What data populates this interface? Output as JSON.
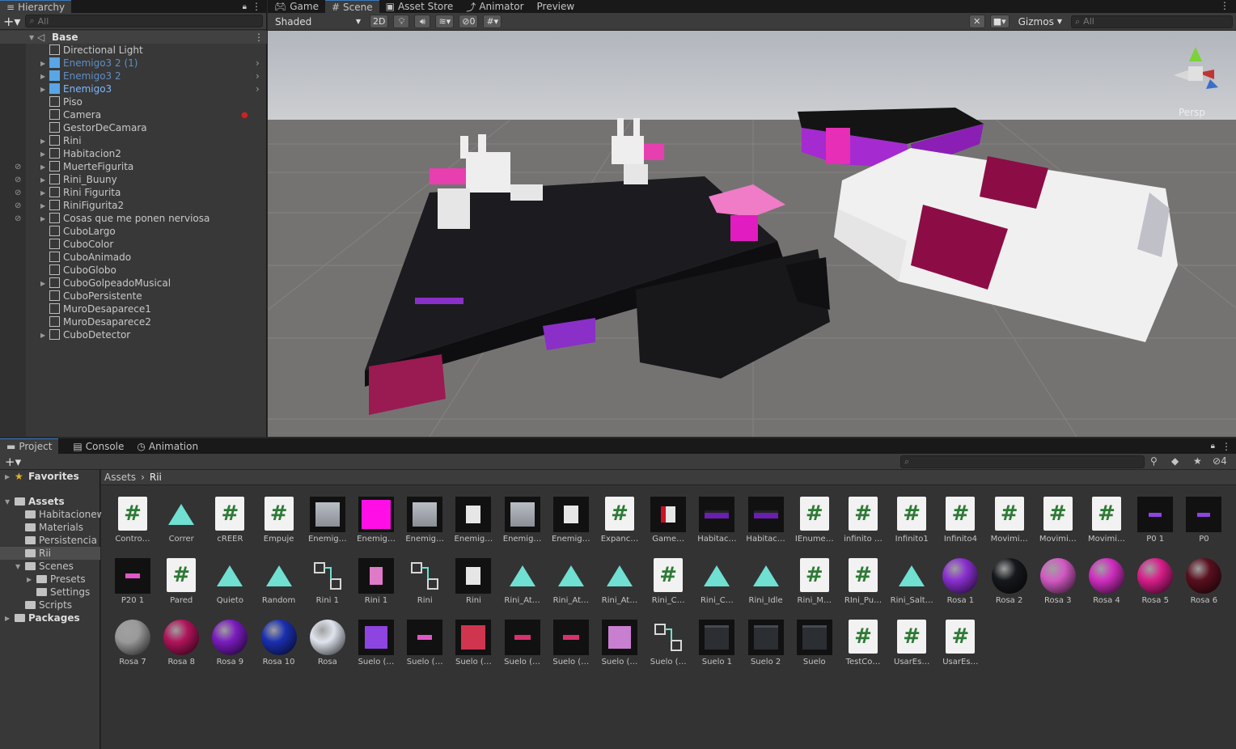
{
  "hierarchy": {
    "tab_label": "Hierarchy",
    "search_placeholder": "All",
    "scene_name": "Base",
    "items": [
      {
        "label": "Directional Light",
        "prefab": false,
        "muted": false
      },
      {
        "label": "Enemigo3 2 (1)",
        "prefab": true,
        "muted": true
      },
      {
        "label": "Enemigo3 2",
        "prefab": true,
        "muted": true
      },
      {
        "label": "Enemigo3",
        "prefab": true,
        "muted": false
      },
      {
        "label": "Piso",
        "prefab": false,
        "muted": false
      },
      {
        "label": "Camera",
        "prefab": false,
        "muted": false
      },
      {
        "label": "GestorDeCamara",
        "prefab": false,
        "muted": false
      },
      {
        "label": "Rini",
        "prefab": false,
        "muted": false
      },
      {
        "label": "Habitacion2",
        "prefab": false,
        "muted": false
      },
      {
        "label": "MuerteFigurita",
        "prefab": false,
        "muted": false
      },
      {
        "label": "Rini_Buuny",
        "prefab": false,
        "muted": false
      },
      {
        "label": "Rini Figurita",
        "prefab": false,
        "muted": false
      },
      {
        "label": "RiniFigurita2",
        "prefab": false,
        "muted": false
      },
      {
        "label": "Cosas que me ponen nerviosa",
        "prefab": false,
        "muted": false
      },
      {
        "label": "CuboLargo",
        "prefab": false,
        "muted": false
      },
      {
        "label": "CuboColor",
        "prefab": false,
        "muted": false
      },
      {
        "label": "CuboAnimado",
        "prefab": false,
        "muted": false
      },
      {
        "label": "CuboGlobo",
        "prefab": false,
        "muted": false
      },
      {
        "label": "CuboGolpeadoMusical",
        "prefab": false,
        "muted": false
      },
      {
        "label": "CuboPersistente",
        "prefab": false,
        "muted": false
      },
      {
        "label": "MuroDesaparece1",
        "prefab": false,
        "muted": false
      },
      {
        "label": "MuroDesaparece2",
        "prefab": false,
        "muted": false
      },
      {
        "label": "CuboDetector",
        "prefab": false,
        "muted": false
      }
    ]
  },
  "scene_tabs": [
    "Game",
    "Scene",
    "Asset Store",
    "Animator",
    "Preview"
  ],
  "scene_toolbar": {
    "shading": "Shaded",
    "mode_2d": "2D",
    "hidden_count": "0",
    "gizmos": "Gizmos",
    "search_placeholder": "All",
    "persp": "Persp"
  },
  "project_tabs": [
    "Project",
    "Console",
    "Animation"
  ],
  "project_toolbar": {
    "hidden_count": "4"
  },
  "project_tree": {
    "favorites": "Favorites",
    "assets": "Assets",
    "folders": [
      "Habitacionew",
      "Materials",
      "Persistencia",
      "Rii",
      "Scenes",
      "Presets",
      "Settings",
      "Scripts"
    ],
    "packages": "Packages"
  },
  "breadcrumb": [
    "Assets",
    "Rii"
  ],
  "assets_row1": [
    {
      "name": "Contro…",
      "kind": "script"
    },
    {
      "name": "Correr",
      "kind": "anim"
    },
    {
      "name": "cREER",
      "kind": "script"
    },
    {
      "name": "Empuje",
      "kind": "script"
    },
    {
      "name": "Enemig…",
      "kind": "greycube"
    },
    {
      "name": "Enemig…",
      "kind": "magentacube"
    },
    {
      "name": "Enemig…",
      "kind": "greycube"
    },
    {
      "name": "Enemig…",
      "kind": "bunny"
    },
    {
      "name": "Enemig…",
      "kind": "greycube"
    },
    {
      "name": "Enemig…",
      "kind": "bunny"
    },
    {
      "name": "Expanc…",
      "kind": "script"
    },
    {
      "name": "Game…",
      "kind": "bunnyred"
    },
    {
      "name": "Habitac…",
      "kind": "room"
    },
    {
      "name": "Habitac…",
      "kind": "room"
    },
    {
      "name": "IEnume…",
      "kind": "script"
    },
    {
      "name": "infinito …",
      "kind": "script"
    },
    {
      "name": "Infinito1",
      "kind": "script"
    },
    {
      "name": "Infinito4",
      "kind": "script"
    },
    {
      "name": "Movimi…",
      "kind": "script"
    },
    {
      "name": "Movimi…",
      "kind": "script"
    },
    {
      "name": "Movimi…",
      "kind": "script"
    },
    {
      "name": "P0 1",
      "kind": "purpleflat"
    },
    {
      "name": "P0",
      "kind": "purpleflat"
    }
  ],
  "assets_row2": [
    {
      "name": "P20 1",
      "kind": "pinkflat"
    },
    {
      "name": "Pared",
      "kind": "script"
    },
    {
      "name": "Quieto",
      "kind": "anim"
    },
    {
      "name": "Random",
      "kind": "anim"
    },
    {
      "name": "Rini 1",
      "kind": "controller"
    },
    {
      "name": "Rini 1",
      "kind": "pinkbunny"
    },
    {
      "name": "Rini",
      "kind": "controller"
    },
    {
      "name": "Rini",
      "kind": "bunny"
    },
    {
      "name": "Rini_At…",
      "kind": "anim"
    },
    {
      "name": "Rini_At…",
      "kind": "anim"
    },
    {
      "name": "Rini_At…",
      "kind": "anim"
    },
    {
      "name": "Rini_C…",
      "kind": "script"
    },
    {
      "name": "Rini_C…",
      "kind": "anim"
    },
    {
      "name": "Rini_Idle",
      "kind": "anim"
    },
    {
      "name": "Rini_M…",
      "kind": "script"
    },
    {
      "name": "RIni_Pu…",
      "kind": "script"
    },
    {
      "name": "Rini_Salt…",
      "kind": "anim"
    },
    {
      "name": "Rosa 1",
      "kind": "sphere",
      "color": "#8a2fd0"
    },
    {
      "name": "Rosa 2",
      "kind": "sphere",
      "color": "#15181c"
    },
    {
      "name": "Rosa 3",
      "kind": "sphere",
      "color": "#d45ac4"
    },
    {
      "name": "Rosa 4",
      "kind": "sphere",
      "color": "#d02ec0"
    },
    {
      "name": "Rosa 5",
      "kind": "sphere",
      "color": "#d81e8a"
    },
    {
      "name": "Rosa 6",
      "kind": "sphere",
      "color": "#5a0f1e"
    }
  ],
  "assets_row3": [
    {
      "name": "Rosa 7",
      "kind": "sphere",
      "color": "#9a9a9a"
    },
    {
      "name": "Rosa 8",
      "kind": "sphere",
      "color": "#b0145a"
    },
    {
      "name": "Rosa 9",
      "kind": "sphere",
      "color": "#7a1cbf"
    },
    {
      "name": "Rosa 10",
      "kind": "sphere",
      "color": "#1a2fb0"
    },
    {
      "name": "Rosa",
      "kind": "sphere",
      "color": "#dfe4ee"
    },
    {
      "name": "Suelo (…",
      "kind": "purplecube"
    },
    {
      "name": "Suelo (…",
      "kind": "pinkflat"
    },
    {
      "name": "Suelo (…",
      "kind": "redcube"
    },
    {
      "name": "Suelo (…",
      "kind": "pinkflat2"
    },
    {
      "name": "Suelo (…",
      "kind": "pinkflat2"
    },
    {
      "name": "Suelo (…",
      "kind": "lilaccube"
    },
    {
      "name": "Suelo (…",
      "kind": "controller"
    },
    {
      "name": "Suelo 1",
      "kind": "blackcube"
    },
    {
      "name": "Suelo 2",
      "kind": "blackcube"
    },
    {
      "name": "Suelo",
      "kind": "blackcube"
    },
    {
      "name": "TestCo…",
      "kind": "script"
    },
    {
      "name": "UsarEs…",
      "kind": "script"
    },
    {
      "name": "UsarEs…",
      "kind": "script"
    }
  ],
  "colors": {
    "panel": "#383838",
    "toolbar": "#3c3c3c",
    "tabbar": "#191919",
    "selection": "#2c5d87",
    "prefab_blue": "#7bb7ff",
    "script_green": "#2d7a35",
    "anim_teal": "#6fe0d2"
  }
}
